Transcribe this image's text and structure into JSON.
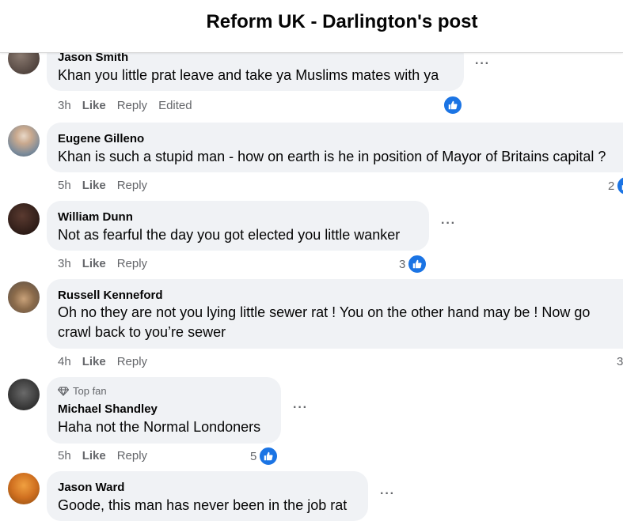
{
  "header": {
    "title": "Reform UK - Darlington's post"
  },
  "colors": {
    "like_blue": "#1b74e4",
    "bubble_bg": "#f0f2f5",
    "meta_gray": "#65676b"
  },
  "comments": [
    {
      "author": "Jason Smith",
      "text": "Khan you little prat leave and take ya Muslims mates with ya",
      "time": "3h",
      "like_label": "Like",
      "reply_label": "Reply",
      "edited_label": "Edited",
      "reaction_count": "",
      "avatar_icon": "avatar-photo"
    },
    {
      "author": "Eugene Gilleno",
      "text": "Khan is such a stupid man - how on earth is he in position of Mayor of Britains capital ?",
      "time": "5h",
      "like_label": "Like",
      "reply_label": "Reply",
      "reaction_count": "2",
      "avatar_icon": "avatar-photo"
    },
    {
      "author": "William Dunn",
      "text": "Not as fearful the day you got elected you little wanker",
      "time": "3h",
      "like_label": "Like",
      "reply_label": "Reply",
      "reaction_count": "3",
      "avatar_icon": "avatar-photo"
    },
    {
      "author": "Russell Kenneford",
      "text": "Oh no they are not you lying little sewer rat ! You on the other hand may be ! Now go crawl back to you’re sewer",
      "time": "4h",
      "like_label": "Like",
      "reply_label": "Reply",
      "reaction_count": "3",
      "avatar_icon": "avatar-photo"
    },
    {
      "author": "Michael Shandley",
      "badge": "Top fan",
      "badge_icon": "diamond-icon",
      "text": "Haha not the Normal Londoners",
      "time": "5h",
      "like_label": "Like",
      "reply_label": "Reply",
      "reaction_count": "5",
      "avatar_icon": "avatar-photo"
    },
    {
      "author": "Jason Ward",
      "text": "Goode, this man has never been in the job rat",
      "time": "",
      "like_label": "",
      "reply_label": "",
      "reaction_count": "",
      "avatar_icon": "avatar-photo"
    }
  ],
  "more_label": "···"
}
